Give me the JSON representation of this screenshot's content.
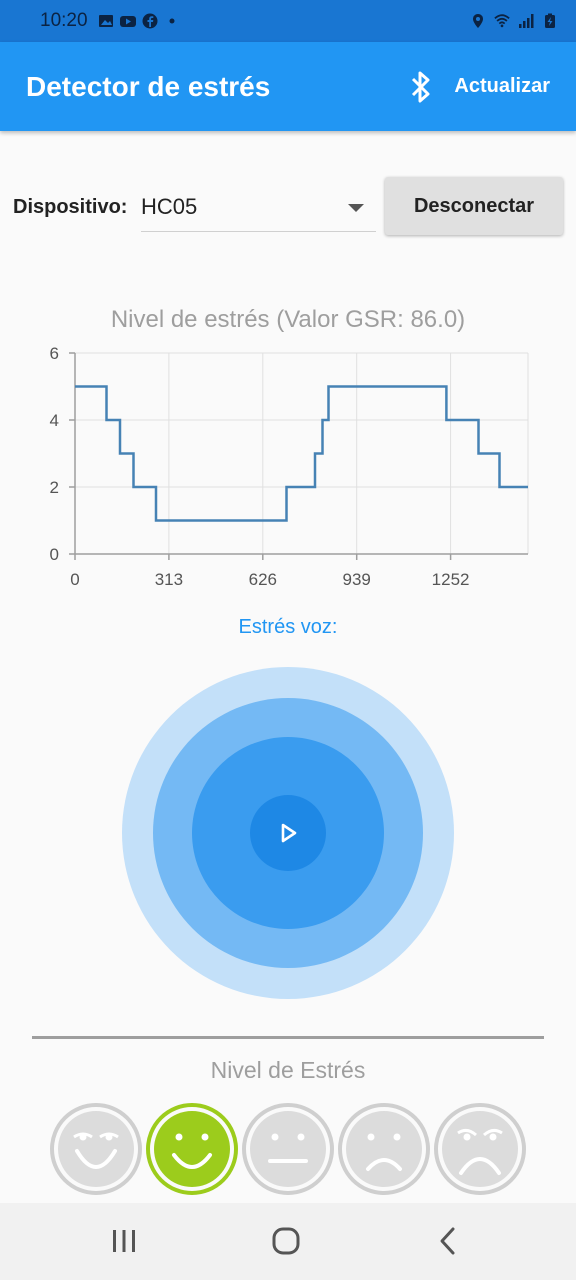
{
  "status_bar": {
    "time": "10:20",
    "left_icons": [
      "image-icon",
      "youtube-icon",
      "facebook-icon",
      "dot-icon"
    ],
    "right_icons": [
      "location-icon",
      "wifi-icon",
      "signal-icon",
      "battery-icon"
    ]
  },
  "app_bar": {
    "title": "Detector de estrés",
    "refresh_label": "Actualizar",
    "icon": "bluetooth-icon"
  },
  "device": {
    "label": "Dispositivo:",
    "selected": "HC05",
    "disconnect_label": "Desconectar"
  },
  "chart_title": "Nivel de estrés (Valor GSR: 86.0)",
  "chart_data": {
    "type": "line",
    "step": true,
    "xlim": [
      0,
      1510
    ],
    "ylim": [
      0,
      6
    ],
    "x_ticks": [
      "0",
      "313",
      "626",
      "939",
      "1252"
    ],
    "y_ticks": [
      "0",
      "2",
      "4",
      "6"
    ],
    "grid": true,
    "points": [
      [
        0,
        5
      ],
      [
        105,
        5
      ],
      [
        105,
        4
      ],
      [
        150,
        4
      ],
      [
        150,
        3
      ],
      [
        195,
        3
      ],
      [
        195,
        2
      ],
      [
        270,
        2
      ],
      [
        270,
        1
      ],
      [
        705,
        1
      ],
      [
        705,
        2
      ],
      [
        800,
        2
      ],
      [
        800,
        3
      ],
      [
        825,
        3
      ],
      [
        825,
        4
      ],
      [
        845,
        4
      ],
      [
        845,
        5
      ],
      [
        1238,
        5
      ],
      [
        1238,
        4
      ],
      [
        1345,
        4
      ],
      [
        1345,
        3
      ],
      [
        1415,
        3
      ],
      [
        1415,
        2
      ],
      [
        1510,
        2
      ]
    ],
    "color": "#4682b4"
  },
  "voice": {
    "label": "Estrés voz:",
    "play_icon": "play-icon"
  },
  "stress": {
    "title": "Nivel de Estrés",
    "faces": [
      {
        "name": "very-happy",
        "active": false
      },
      {
        "name": "happy",
        "active": true
      },
      {
        "name": "neutral",
        "active": false
      },
      {
        "name": "sad",
        "active": false
      },
      {
        "name": "very-sad",
        "active": false
      }
    ],
    "active_color": "#9ccc1c"
  },
  "nav_bar": {
    "icons": [
      "recents-icon",
      "home-icon",
      "back-icon"
    ]
  }
}
